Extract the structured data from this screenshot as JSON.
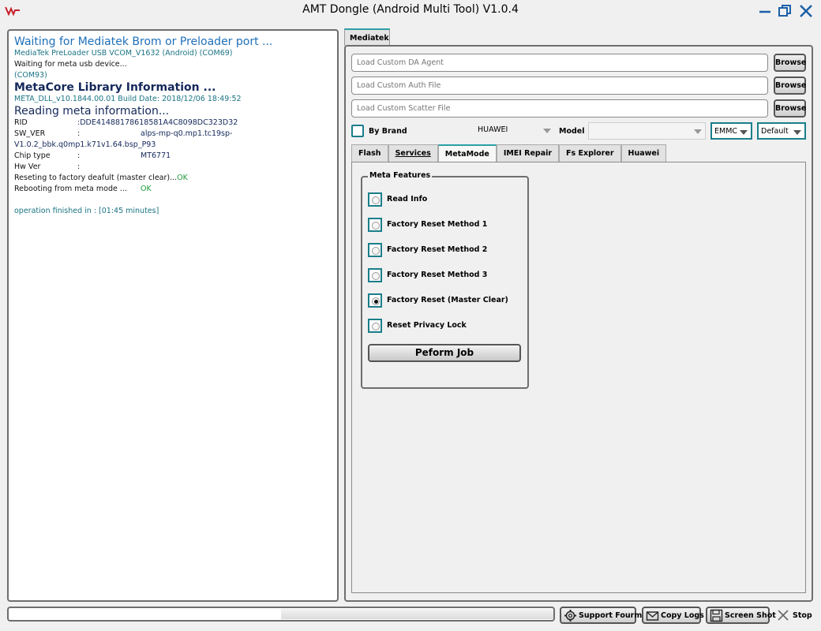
{
  "window": {
    "title": "AMT Dongle (Android Multi Tool) V1.0.4"
  },
  "log": {
    "lines": {
      "l1": "Waiting for Mediatek Brom or Preloader port ...",
      "l2": "MediaTek PreLoader USB VCOM_V1632 (Android) (COM69)",
      "l3": "Waiting for meta usb device...",
      "l4": "(COM93)",
      "l5": "MetaCore Library Information ...",
      "l6": "META_DLL_v10.1844.00.01 Build Date: 2018/12/06 18:49:52",
      "l7": "Reading meta information...",
      "rid_key": "RID",
      "rid_val": ":DDE41488178618581A4C8098DC323D32",
      "sw_key": "SW_VER",
      "sw_sep": ":",
      "sw_val": "alps-mp-q0.mp1.tc19sp-",
      "sw_val2": "V1.0.2_bbk.q0mp1.k71v1.64.bsp_P93",
      "chip_key": "Chip type",
      "chip_sep": ":",
      "chip_val": "MT6771",
      "hw_key": "Hw Ver",
      "hw_sep": ":",
      "reset_text": "Reseting to factory deafult (master clear)...",
      "reset_ok": "OK",
      "reboot_text": "Rebooting from meta mode ...",
      "reboot_ok": "OK",
      "finished": "operation finished in : [01:45 minutes]"
    }
  },
  "main_tab": "Mediatek",
  "files": {
    "da_placeholder": "Load Custom DA Agent",
    "auth_placeholder": "Load Custom Auth File",
    "scatter_placeholder": "Load Custom Scatter File",
    "browse_label": "Browse"
  },
  "brand_row": {
    "by_brand_label": "By Brand",
    "brand_value": "HUAWEI",
    "model_label": "Model",
    "model_value": "",
    "storage_value": "EMMC",
    "mode_value": "Default"
  },
  "sub_tabs": [
    "Flash",
    "Services",
    "MetaMode",
    "IMEI Repair",
    "Fs Explorer",
    "Huawei"
  ],
  "meta_features": {
    "title": "Meta Features",
    "options": [
      {
        "label": "Read Info",
        "selected": false
      },
      {
        "label": "Factory Reset Method 1",
        "selected": false
      },
      {
        "label": "Factory Reset Method 2",
        "selected": false
      },
      {
        "label": "Factory Reset Method 3",
        "selected": false
      },
      {
        "label": "Factory Reset (Master Clear)",
        "selected": true
      },
      {
        "label": "Reset Privacy Lock",
        "selected": false
      }
    ],
    "perform_label": "Peform Job"
  },
  "bottom": {
    "support_label": "Support Fourm",
    "copy_logs_label": "Copy Logs",
    "screenshot_label": "Screen Shot",
    "stop_label": "Stop"
  },
  "colors": {
    "accent_teal": "#1a7e8a",
    "log_blue": "#1e6fb8",
    "ok_green": "#1f9a3b"
  }
}
